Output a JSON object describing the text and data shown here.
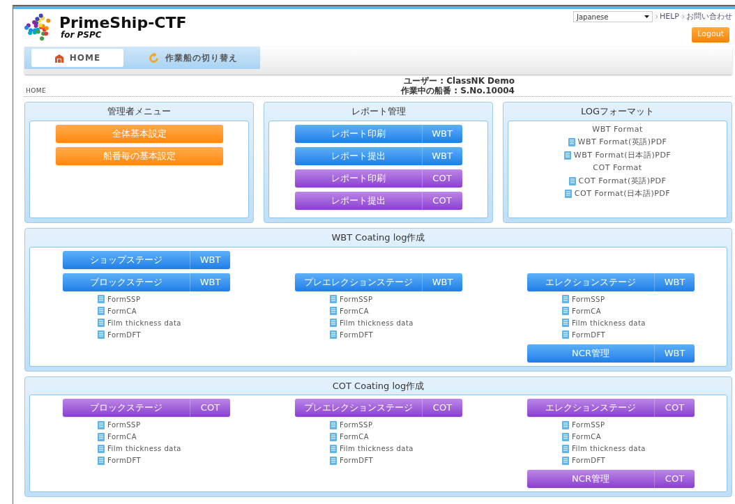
{
  "header": {
    "title": "PrimeShip-CTF",
    "subtitle": "for PSPC",
    "language": "Japanese",
    "links": [
      "HELP",
      "お問い合わせ"
    ],
    "logout": "Logout"
  },
  "tabs": [
    {
      "label": "HOME",
      "kind": "home",
      "selected": true
    },
    {
      "label": "作業船の切り替え",
      "kind": "switch",
      "selected": false
    }
  ],
  "breadcrumb": "HOME",
  "user_info": [
    "ユーザー : ClassNK Demo",
    "作業中の船番 : S.No.10004"
  ],
  "panels": [
    {
      "title": "管理者メニュー",
      "kind": "buttons",
      "buttons": [
        {
          "label": "全体基本設定",
          "kind": "orange"
        },
        {
          "label": "船番毎の基本設定",
          "kind": "orange"
        }
      ]
    },
    {
      "title": "レポート管理",
      "kind": "buttons",
      "buttons": [
        {
          "label": "レポート印刷",
          "tag": "WBT",
          "kind": "wbt"
        },
        {
          "label": "レポート提出",
          "tag": "WBT",
          "kind": "wbt"
        },
        {
          "label": "レポート印刷",
          "tag": "COT",
          "kind": "cot"
        },
        {
          "label": "レポート提出",
          "tag": "COT",
          "kind": "cot"
        }
      ]
    },
    {
      "title": "LOGフォーマット",
      "kind": "formats",
      "items": [
        {
          "label": "WBT Format",
          "kind": "heading"
        },
        {
          "label": "WBT Format(英語)PDF",
          "kind": "file"
        },
        {
          "label": "WBT Format(日本語)PDF",
          "kind": "file"
        },
        {
          "label": "COT Format",
          "kind": "heading"
        },
        {
          "label": "COT Format(英語)PDF",
          "kind": "file"
        },
        {
          "label": "COT Format(日本語)PDF",
          "kind": "file"
        }
      ]
    }
  ],
  "sections": [
    {
      "title": "WBT Coating log作成",
      "extra_buttons": [
        {
          "label": "ショップステージ",
          "tag": "WBT",
          "kind": "wbt"
        }
      ],
      "columns": [
        {
          "button": {
            "label": "ブロックステージ",
            "tag": "WBT",
            "kind": "wbt"
          },
          "links": [
            "FormSSP",
            "FormCA",
            "Film thickness data",
            "FormDFT"
          ]
        },
        {
          "button": {
            "label": "プレエレクションステージ",
            "tag": "WBT",
            "kind": "wbt"
          },
          "links": [
            "FormSSP",
            "FormCA",
            "Film thickness data",
            "FormDFT"
          ]
        },
        {
          "button": {
            "label": "エレクションステージ",
            "tag": "WBT",
            "kind": "wbt"
          },
          "links": [
            "FormSSP",
            "FormCA",
            "Film thickness data",
            "FormDFT"
          ],
          "footer_button": {
            "label": "NCR管理",
            "tag": "WBT",
            "kind": "wbt"
          }
        }
      ]
    },
    {
      "title": "COT Coating log作成",
      "columns": [
        {
          "button": {
            "label": "ブロックステージ",
            "tag": "COT",
            "kind": "cot"
          },
          "links": [
            "FormSSP",
            "FormCA",
            "Film thickness data",
            "FormDFT"
          ]
        },
        {
          "button": {
            "label": "プレエレクションステージ",
            "tag": "COT",
            "kind": "cot"
          },
          "links": [
            "FormSSP",
            "FormCA",
            "Film thickness data",
            "FormDFT"
          ]
        },
        {
          "button": {
            "label": "エレクションステージ",
            "tag": "COT",
            "kind": "cot"
          },
          "links": [
            "FormSSP",
            "FormCA",
            "Film thickness data",
            "FormDFT"
          ],
          "footer_button": {
            "label": "NCR管理",
            "tag": "COT",
            "kind": "cot"
          }
        }
      ]
    }
  ]
}
